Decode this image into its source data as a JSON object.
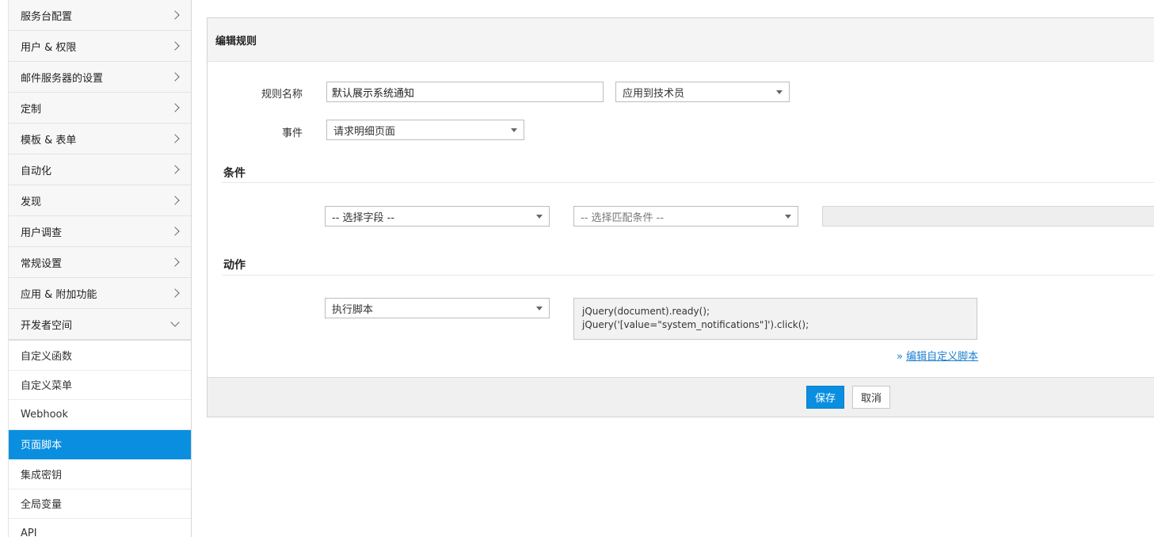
{
  "sidebar": {
    "menu": [
      {
        "label": "服务台配置",
        "icon": "chevron-right-icon"
      },
      {
        "label": "用户 & 权限",
        "icon": "chevron-right-icon"
      },
      {
        "label": "邮件服务器的设置",
        "icon": "chevron-right-icon"
      },
      {
        "label": "定制",
        "icon": "chevron-right-icon"
      },
      {
        "label": "模板 & 表单",
        "icon": "chevron-right-icon"
      },
      {
        "label": "自动化",
        "icon": "chevron-right-icon"
      },
      {
        "label": "发现",
        "icon": "chevron-right-icon"
      },
      {
        "label": "用户调查",
        "icon": "chevron-right-icon"
      },
      {
        "label": "常规设置",
        "icon": "chevron-right-icon"
      },
      {
        "label": "应用 & 附加功能",
        "icon": "chevron-right-icon"
      },
      {
        "label": "开发者空间",
        "icon": "chevron-down-icon"
      }
    ],
    "submenu": [
      {
        "label": "自定义函数"
      },
      {
        "label": "自定义菜单"
      },
      {
        "label": "Webhook"
      },
      {
        "label": "页面脚本",
        "active": true
      },
      {
        "label": "集成密钥"
      },
      {
        "label": "全局变量"
      },
      {
        "label": "API"
      }
    ]
  },
  "panel": {
    "title": "编辑规则",
    "rule_name_label": "规则名称",
    "rule_name_value": "默认展示系统通知",
    "apply_to_value": "应用到技术员",
    "event_label": "事件",
    "event_value": "请求明细页面",
    "conditions_title": "条件",
    "field_select_placeholder": "-- 选择字段 --",
    "match_select_placeholder": "-- 选择匹配条件 --",
    "actions_title": "动作",
    "action_select_value": "执行脚本",
    "script_line1": "jQuery(document).ready();",
    "script_line2": "jQuery('[value=\"system_notifications\"]').click();",
    "edit_link_prefix": "»",
    "edit_link_text": "编辑自定义脚本",
    "save_label": "保存",
    "cancel_label": "取消"
  },
  "colors": {
    "accent": "#0a8fe0",
    "link": "#1a7fd0"
  }
}
